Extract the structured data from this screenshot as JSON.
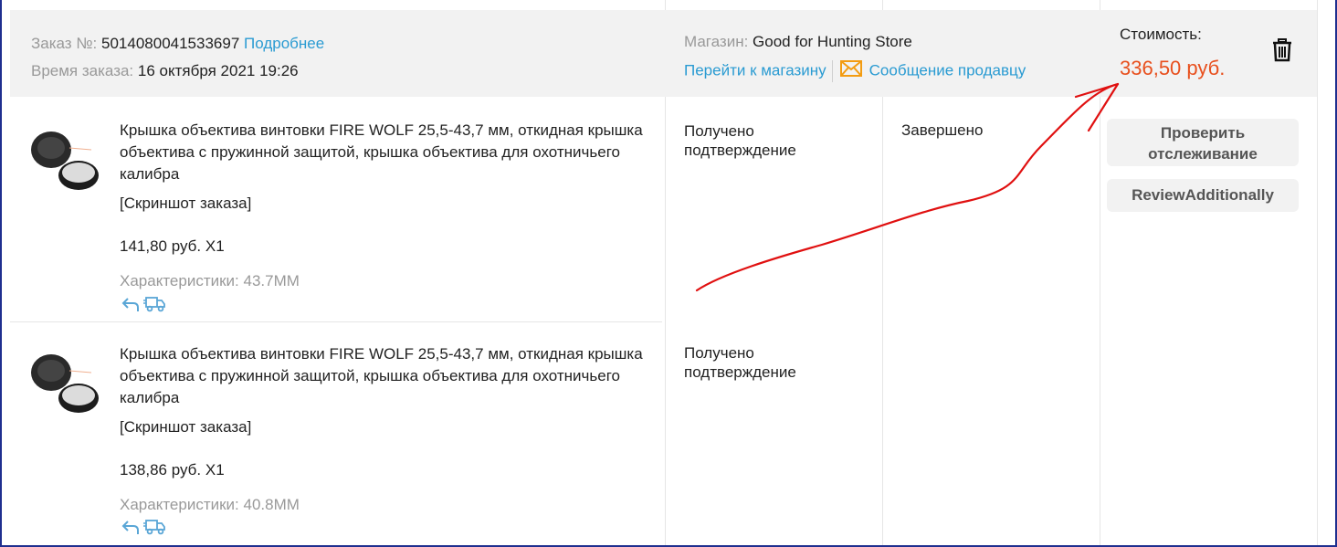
{
  "order": {
    "number_label": "Заказ №:",
    "number": "5014080041533697",
    "details_link": "Подробнее",
    "time_label": "Время заказа:",
    "time": "16 октября 2021 19:26",
    "store_label": "Магазин:",
    "store_name": "Good for Hunting Store",
    "goto_store": "Перейти к магазину",
    "message_seller": "Сообщение продавцу",
    "cost_label": "Стоимость:",
    "cost_total": "336,50 руб."
  },
  "items": [
    {
      "title": "Крышка объектива винтовки FIRE WOLF 25,5-43,7 мм, откидная крышка объектива с пружинной защитой, крышка объектива для охотничьего калибра",
      "screenshot": "[Скриншот заказа]",
      "price": "141,80 руб. X1",
      "spec": "Характеристики: 43.7MM",
      "status": "Получено подтверждение"
    },
    {
      "title": "Крышка объектива винтовки FIRE WOLF 25,5-43,7 мм, откидная крышка объектива с пружинной защитой, крышка объектива для охотничьего калибра",
      "screenshot": "[Скриншот заказа]",
      "price": "138,86 руб. X1",
      "spec": "Характеристики: 40.8MM",
      "status": "Получено подтверждение"
    }
  ],
  "order_status": "Завершено",
  "actions": {
    "track": "Проверить отслеживание",
    "review": "ReviewAdditionally"
  },
  "colors": {
    "link": "#2a9bd2",
    "price_accent": "#e8501e",
    "header_bg": "#f2f2f2",
    "annotation": "#e01010"
  }
}
